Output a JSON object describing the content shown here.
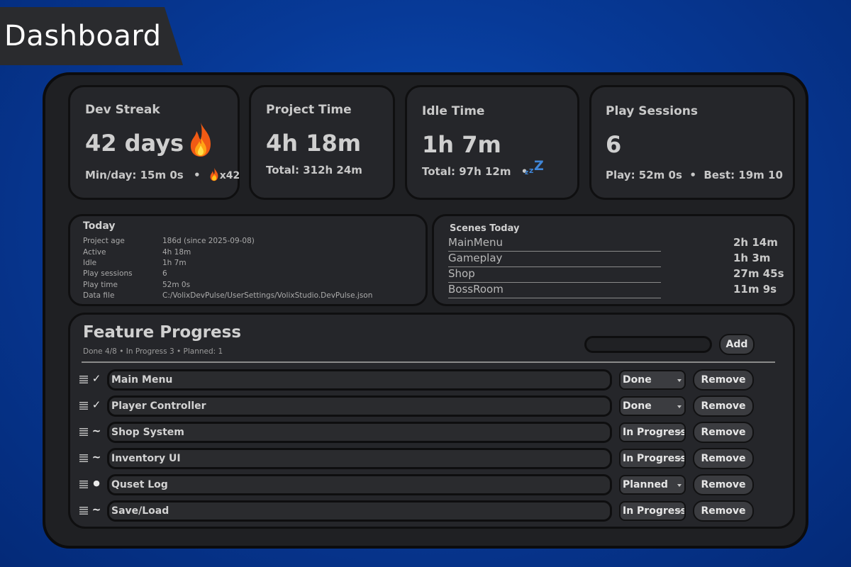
{
  "header": {
    "title": "Dashboard"
  },
  "stats": {
    "dev_streak": {
      "title": "Dev Streak",
      "value": "42 days",
      "min_per_day": "Min/day: 15m 0s",
      "bullet": "•",
      "streak_badge": "x42"
    },
    "project_time": {
      "title": "Project Time",
      "value": "4h 18m",
      "total": "Total: 312h 24m"
    },
    "idle_time": {
      "title": "Idle Time",
      "value": "1h 7m",
      "total": "Total: 97h 12m",
      "bullet": "•",
      "zzz": [
        "z",
        "z",
        "Z"
      ]
    },
    "play_sessions": {
      "title": "Play Sessions",
      "value": "6",
      "detail": "Play: 52m 0s  •  Best: 19m 10"
    }
  },
  "today": {
    "title": "Today",
    "rows": [
      {
        "label": "Project age",
        "value": "186d (since 2025-09-08)"
      },
      {
        "label": "Active",
        "value": "4h 18m"
      },
      {
        "label": "Idle",
        "value": "1h 7m"
      },
      {
        "label": "Play sessions",
        "value": "6"
      },
      {
        "label": "Play time",
        "value": "52m 0s"
      },
      {
        "label": "Data file",
        "value": "C:/VolixDevPulse/UserSettings/VolixStudio.DevPulse.json"
      }
    ]
  },
  "scenes": {
    "title": "Scenes Today",
    "rows": [
      {
        "name": "MainMenu",
        "time": "2h 14m"
      },
      {
        "name": "Gameplay",
        "time": "1h 3m"
      },
      {
        "name": "Shop",
        "time": "27m 45s"
      },
      {
        "name": "BossRoom",
        "time": "11m 9s"
      }
    ]
  },
  "features": {
    "title": "Feature Progress",
    "summary": "Done 4/8 • In Progress 3 • Planned: 1",
    "new_feature_value": "",
    "add_label": "Add",
    "remove_label": "Remove",
    "items": [
      {
        "name": "Main Menu",
        "status": "Done",
        "mark": "✓"
      },
      {
        "name": "Player Controller",
        "status": "Done",
        "mark": "✓"
      },
      {
        "name": "Shop System",
        "status": "In Progress",
        "mark": "~"
      },
      {
        "name": "Inventory UI",
        "status": "In Progress",
        "mark": "~"
      },
      {
        "name": "Quset Log",
        "status": "Planned",
        "mark": "●"
      },
      {
        "name": "Save/Load",
        "status": "In Progress",
        "mark": "~"
      }
    ]
  },
  "colors": {
    "background": "#073a98",
    "panel": "#1f2023",
    "card": "#25262a",
    "zzz_accent": "#3f86d8",
    "flame_outer": "#f05a14",
    "flame_inner": "#ffc21a"
  },
  "icons": {
    "flame": "flame-icon",
    "sleep": "zzz-icon",
    "drag": "drag-handle-icon",
    "check": "check-icon",
    "caret": "chevron-down-icon"
  }
}
